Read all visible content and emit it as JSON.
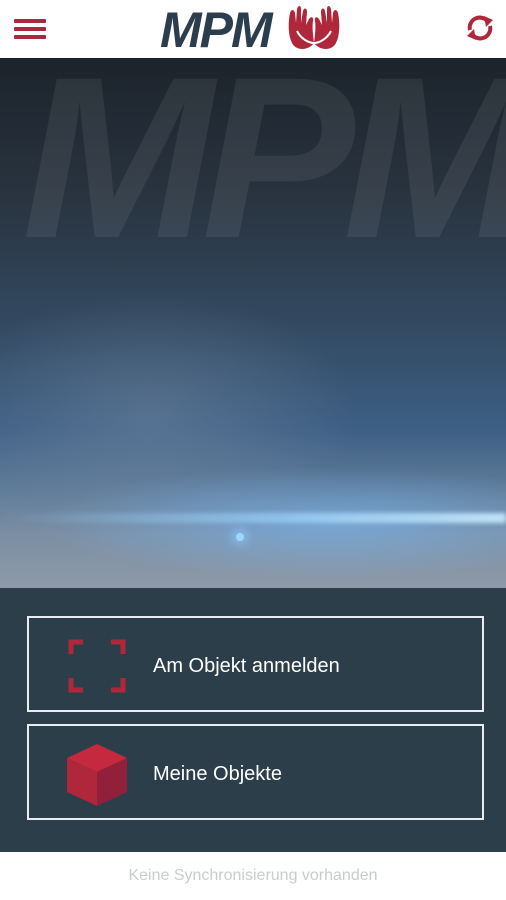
{
  "header": {
    "logo_text": "MPM",
    "menu_icon": "hamburger-menu-icon",
    "logo_icon": "caring-hands-icon",
    "sync_icon": "sync-icon",
    "accent_color": "#b0263a"
  },
  "hero": {
    "watermark_text": "MPM"
  },
  "actions": [
    {
      "label": "Am Objekt anmelden",
      "icon": "scan-frame-icon"
    },
    {
      "label": "Meine Objekte",
      "icon": "cube-icon"
    }
  ],
  "footer": {
    "status_text": "Keine Synchronisierung vorhanden"
  },
  "colors": {
    "panel": "#2d3e4b",
    "accent": "#b0263a",
    "logo_text": "#2c3e4d"
  }
}
